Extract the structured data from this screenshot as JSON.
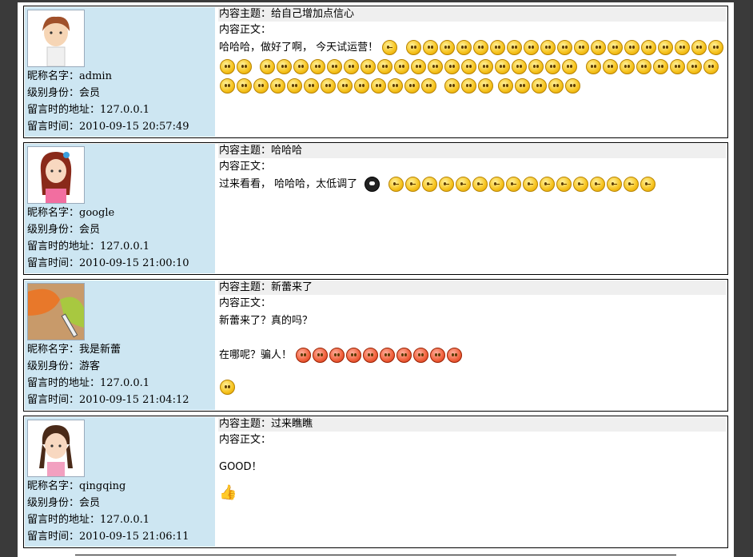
{
  "entries": [
    {
      "nickname_label": "昵称名字：",
      "nickname": "admin",
      "level_label": "级别身份：",
      "level": "会员",
      "ip_label": "留言时的地址：",
      "ip": "127.0.0.1",
      "time_label": "留言时间：",
      "time": "2010-09-15 20:57:49",
      "subject_label": "内容主题：",
      "subject": "给自己增加点信心",
      "body_label": "内容正文：",
      "body_text": "哈哈哈，做好了啊， 今天试运营！",
      "avatar_icon": "boy-avatar-icon"
    },
    {
      "nickname_label": "昵称名字：",
      "nickname": "google",
      "level_label": "级别身份：",
      "level": "会员",
      "ip_label": "留言时的地址：",
      "ip": "127.0.0.1",
      "time_label": "留言时间：",
      "time": "2010-09-15 21:00:10",
      "subject_label": "内容主题：",
      "subject": "哈哈哈",
      "body_label": "内容正文：",
      "body_text": "过来看看， 哈哈哈，太低调了",
      "avatar_icon": "girl-avatar-icon"
    },
    {
      "nickname_label": "昵称名字：",
      "nickname": "我是新蕾",
      "level_label": "级别身份：",
      "level": "游客",
      "ip_label": "留言时的地址：",
      "ip": "127.0.0.1",
      "time_label": "留言时间：",
      "time": "2010-09-15 21:04:12",
      "subject_label": "内容主题：",
      "subject": "新蕾来了",
      "body_label": "内容正文：",
      "body_text": "新蕾来了？真的吗？",
      "body_text2": "在哪呢？骗人！",
      "avatar_icon": "paint-brush-avatar-icon"
    },
    {
      "nickname_label": "昵称名字：",
      "nickname": "qingqing",
      "level_label": "级别身份：",
      "level": "会员",
      "ip_label": "留言时的地址：",
      "ip": "127.0.0.1",
      "time_label": "留言时间：",
      "time": "2010-09-15 21:06:11",
      "subject_label": "内容主题：",
      "subject": "过来瞧瞧",
      "body_label": "内容正文：",
      "body_text": "GOOD！",
      "avatar_icon": "girl-braids-avatar-icon"
    }
  ],
  "colors": {
    "info_bg": "#cde6f2",
    "subject_bg": "#efefef",
    "frame": "#3a3a3a"
  }
}
